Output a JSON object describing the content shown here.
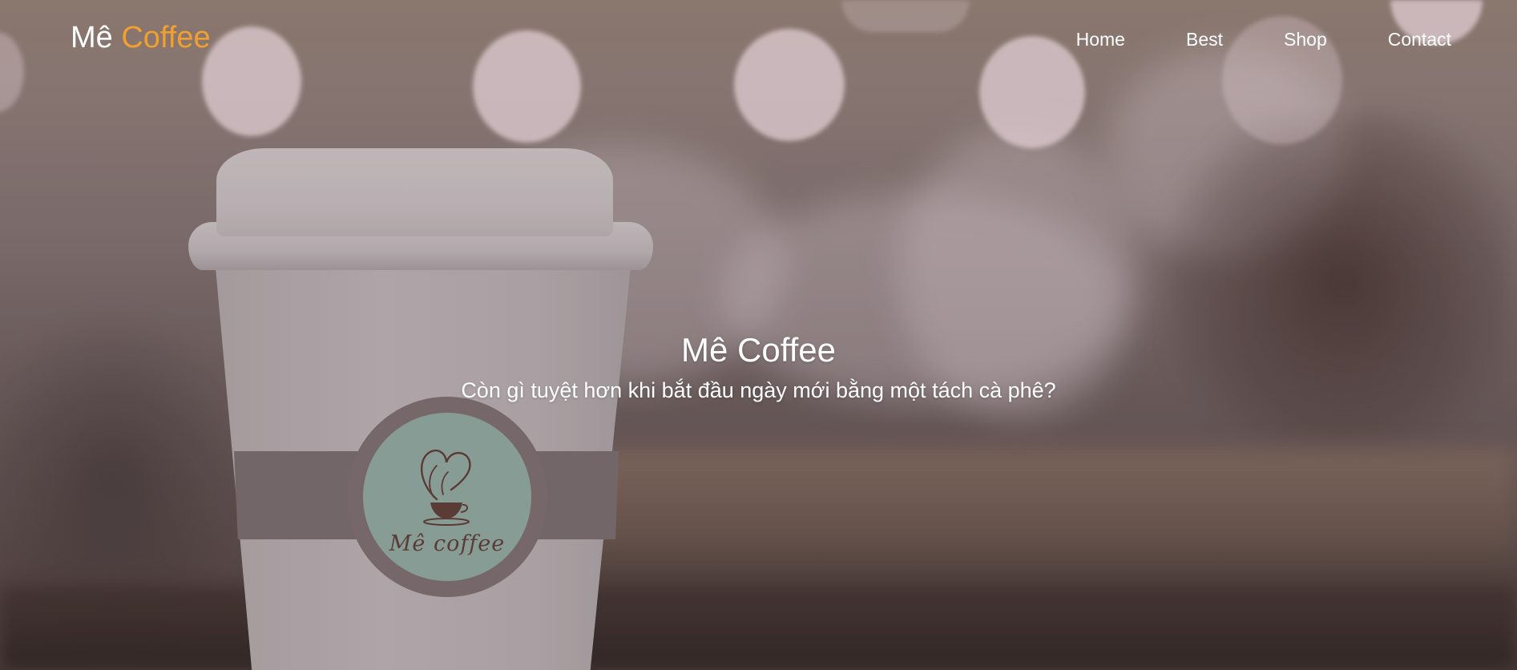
{
  "brand": {
    "name_part1": "Mê",
    "name_part2": "Coffee",
    "accent_color": "#f0a030"
  },
  "nav": {
    "items": [
      {
        "label": "Home"
      },
      {
        "label": "Best"
      },
      {
        "label": "Shop"
      },
      {
        "label": "Contact"
      }
    ]
  },
  "hero": {
    "title": "Mê Coffee",
    "subtitle": "Còn gì tuyệt hơn khi bắt đầu ngày mới bằng một tách cà phê?",
    "background": "blurred-cafe-photo-with-coffee-cup",
    "cup_logo_text": "Mê coffee",
    "cup_logo_icon": "heart-steam-coffee-cup-icon"
  },
  "colors": {
    "text": "#ffffff",
    "accent": "#f0a030",
    "badge": "#8fa59f",
    "badge_text": "#5e3c36"
  }
}
